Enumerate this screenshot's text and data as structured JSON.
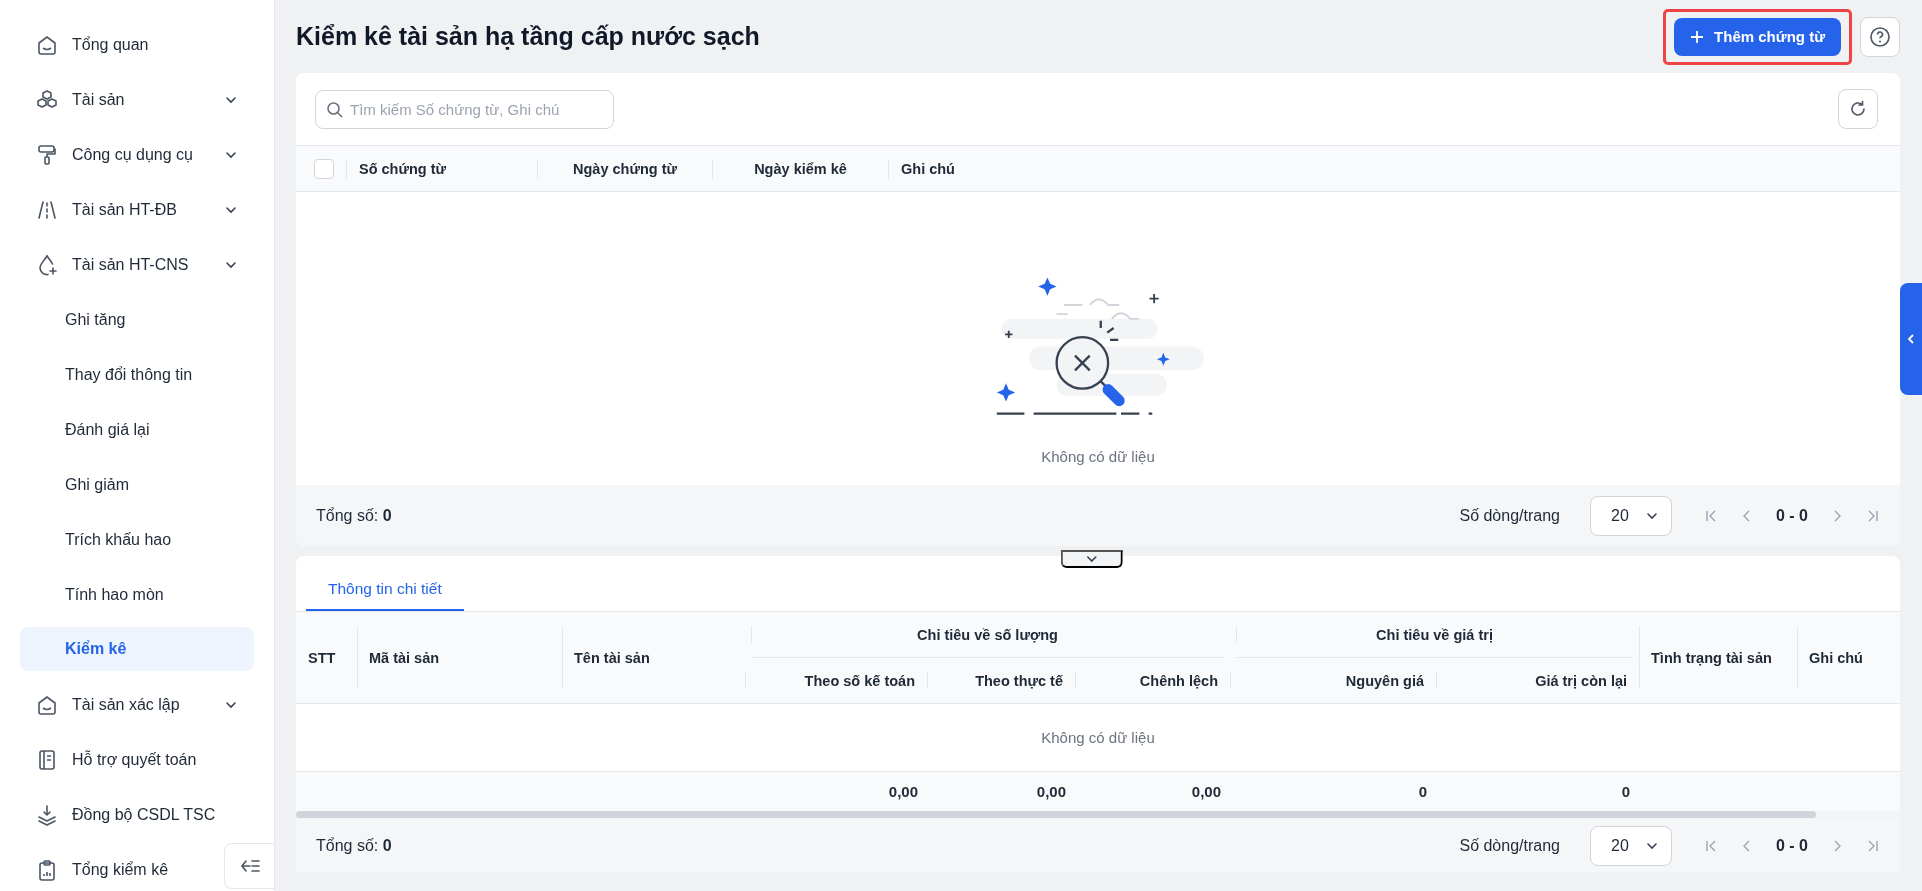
{
  "sidebar": {
    "items": [
      {
        "label": "Tổng quan",
        "kind": "link",
        "selected": false
      },
      {
        "label": "Tài sản",
        "kind": "group",
        "selected": false
      },
      {
        "label": "Công cụ dụng cụ",
        "kind": "group",
        "selected": false
      },
      {
        "label": "Tài sản HT-ĐB",
        "kind": "group",
        "selected": false
      },
      {
        "label": "Tài sản HT-CNS",
        "kind": "group",
        "selected": false,
        "children": [
          {
            "label": "Ghi tăng",
            "selected": false
          },
          {
            "label": "Thay đổi thông tin",
            "selected": false
          },
          {
            "label": "Đánh giá lại",
            "selected": false
          },
          {
            "label": "Ghi giảm",
            "selected": false
          },
          {
            "label": "Trích khấu hao",
            "selected": false
          },
          {
            "label": "Tính hao mòn",
            "selected": false
          },
          {
            "label": "Kiểm kê",
            "selected": true
          }
        ]
      },
      {
        "label": "Tài sản xác lập",
        "kind": "group",
        "selected": false
      },
      {
        "label": "Hỗ trợ quyết toán",
        "kind": "link",
        "selected": false
      },
      {
        "label": "Đồng bộ CSDL TSC",
        "kind": "link",
        "selected": false
      },
      {
        "label": "Tổng kiểm kê",
        "kind": "link",
        "selected": false
      }
    ]
  },
  "page": {
    "title": "Kiểm kê tài sản hạ tầng cấp nước sạch",
    "add_button": {
      "label": "Thêm chứng từ",
      "highlighted": true
    }
  },
  "voucher_table": {
    "search": {
      "placeholder": "Tìm kiếm Số chứng từ, Ghi chú"
    },
    "select_all": {
      "checked": false
    },
    "columns": [
      "Số chứng từ",
      "Ngày chứng từ",
      "Ngày kiểm kê",
      "Ghi chú"
    ],
    "empty_text": "Không có dữ liệu",
    "total": "Tổng số: **0**",
    "rows_per_page_label": "Số dòng/trang",
    "rows_per_page": "20",
    "page_range": "0 - 0"
  },
  "detail_panel": {
    "tabs": [
      {
        "label": "Thông tin chi tiết",
        "selected": true
      }
    ],
    "columns": [
      {
        "label": "STT"
      },
      {
        "label": "Mã tài sản"
      },
      {
        "label": "Tên tài sản"
      },
      {
        "group": "Chỉ tiêu về số lượng",
        "children": [
          {
            "label": "Theo số kế toán",
            "total": "0,00"
          },
          {
            "label": "Theo thực tế",
            "total": "0,00"
          },
          {
            "label": "Chênh lệch",
            "total": "0,00"
          }
        ]
      },
      {
        "group": "Chỉ tiêu về giá trị",
        "children": [
          {
            "label": "Nguyên giá",
            "total": "0"
          },
          {
            "label": "Giá trị còn lại",
            "total": "0"
          }
        ]
      },
      {
        "label": "Tình trạng tài sản"
      },
      {
        "label": "Ghi chú"
      }
    ],
    "empty_text": "Không có dữ liệu",
    "total": "Tổng số: **0**",
    "rows_per_page_label": "Số dòng/trang",
    "rows_per_page": "20",
    "page_range": "0 - 0"
  }
}
